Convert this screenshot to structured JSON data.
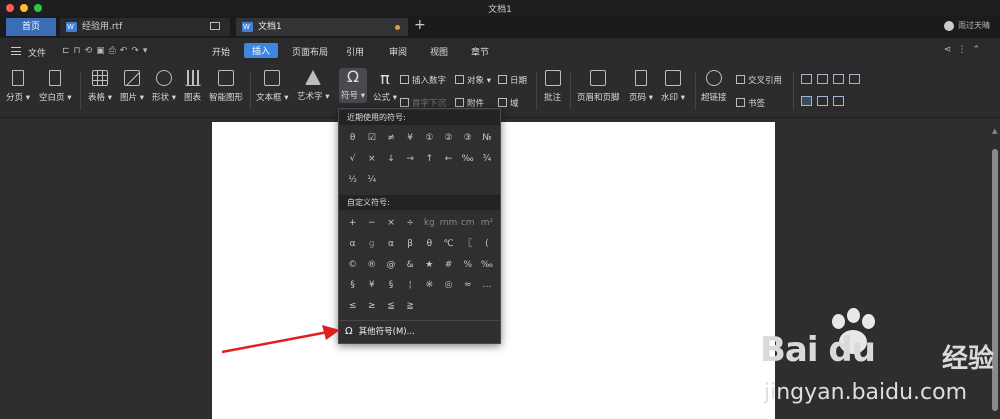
{
  "window": {
    "title": "文档1"
  },
  "tabs": {
    "home": "首页",
    "doc1": "经验用.rtf",
    "doc2": "文档1",
    "user": "雨过天晴"
  },
  "menu": {
    "file": "文件",
    "tabs": [
      "开始",
      "插入",
      "页面布局",
      "引用",
      "审阅",
      "视图",
      "章节"
    ],
    "active_tab": "插入"
  },
  "ribbon": {
    "page_break": "分页",
    "blank_page": "空白页",
    "table": "表格",
    "picture": "图片",
    "shape": "形状",
    "chart": "图表",
    "smart_art": "智能图形",
    "text_box": "文本框",
    "word_art": "艺术字",
    "symbol": "符号",
    "formula": "公式",
    "insert_number": "插入数字",
    "object": "对象",
    "date": "日期",
    "first_letter_sink": "首字下沉",
    "attachment": "附件",
    "field": "域",
    "comment": "批注",
    "header_footer": "页眉和页脚",
    "page_number": "页码",
    "watermark": "水印",
    "hyperlink": "超链接",
    "cross_reference": "交叉引用",
    "bookmark": "书签"
  },
  "symbol_dropdown": {
    "recent_header": "近期使用的符号:",
    "recent": [
      "θ",
      "☑",
      "≠",
      "¥",
      "①",
      "②",
      "③",
      "№",
      "√",
      "×",
      "↓",
      "→",
      "↑",
      "←",
      "‰",
      "¾",
      "½",
      "¼"
    ],
    "custom_header": "自定义符号:",
    "custom": [
      "+",
      "−",
      "×",
      "÷",
      "kg",
      "mm",
      "cm",
      "m²",
      "α",
      "g",
      "α",
      "β",
      "θ",
      "℃",
      "〖",
      "(",
      "©",
      "®",
      "@",
      "&",
      "★",
      "#",
      "%",
      "‰",
      "§",
      "¥",
      "§",
      "¦",
      "※",
      "◎",
      "≈",
      "…",
      "≤",
      "≥",
      "≦",
      "≧"
    ],
    "more_label": "其他符号(M)..."
  },
  "watermark": {
    "logo": "Bai du",
    "product": "经验",
    "url": "jingyan.baidu.com"
  },
  "colors": {
    "accent": "#3e86de",
    "home_tab": "#3a6db5",
    "arrow": "#e02020"
  }
}
